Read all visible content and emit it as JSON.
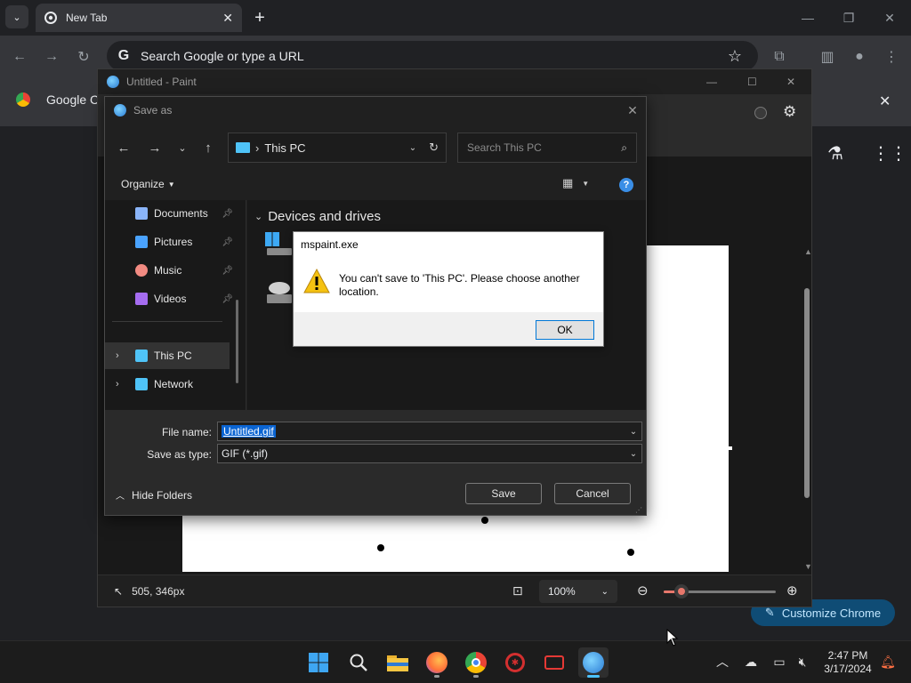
{
  "chrome": {
    "tab_title": "New Tab",
    "omnibox_placeholder": "Search Google or type a URL",
    "bookmark_label": "Google Ch",
    "customize_label": "Customize Chrome"
  },
  "paint": {
    "window_title": "Untitled - Paint",
    "cursor_pos": "505, 346px",
    "zoom_level": "100%",
    "zoom_fraction": 0.16
  },
  "saveas": {
    "title": "Save as",
    "address_location": "This PC",
    "search_placeholder": "Search This PC",
    "organize_label": "Organize",
    "nav_items": [
      {
        "label": "Documents",
        "icon": "documents-icon",
        "color": "#8ab4f8",
        "pinned": true
      },
      {
        "label": "Pictures",
        "icon": "pictures-icon",
        "color": "#4aa3ff",
        "pinned": true
      },
      {
        "label": "Music",
        "icon": "music-icon",
        "color": "#f28b82",
        "pinned": true
      },
      {
        "label": "Videos",
        "icon": "videos-icon",
        "color": "#a56cf0",
        "pinned": true
      },
      {
        "label": "This PC",
        "icon": "computer-icon",
        "color": "#4fc3f7",
        "pinned": false
      },
      {
        "label": "Network",
        "icon": "network-icon",
        "color": "#4fc3f7",
        "pinned": false
      }
    ],
    "section_header": "Devices and drives",
    "file_name_label": "File name:",
    "file_name_value": "Untitled.gif",
    "save_type_label": "Save as type:",
    "save_type_value": "GIF (*.gif)",
    "hide_folders_label": "Hide Folders",
    "save_button": "Save",
    "cancel_button": "Cancel"
  },
  "messagebox": {
    "title": "mspaint.exe",
    "message": "You can't save to 'This PC'. Please choose another location.",
    "ok_button": "OK"
  },
  "taskbar": {
    "time": "2:47 PM",
    "date": "3/17/2024"
  },
  "colors": {
    "accent": "#0078d7",
    "paint_slider": "#e8776b"
  }
}
